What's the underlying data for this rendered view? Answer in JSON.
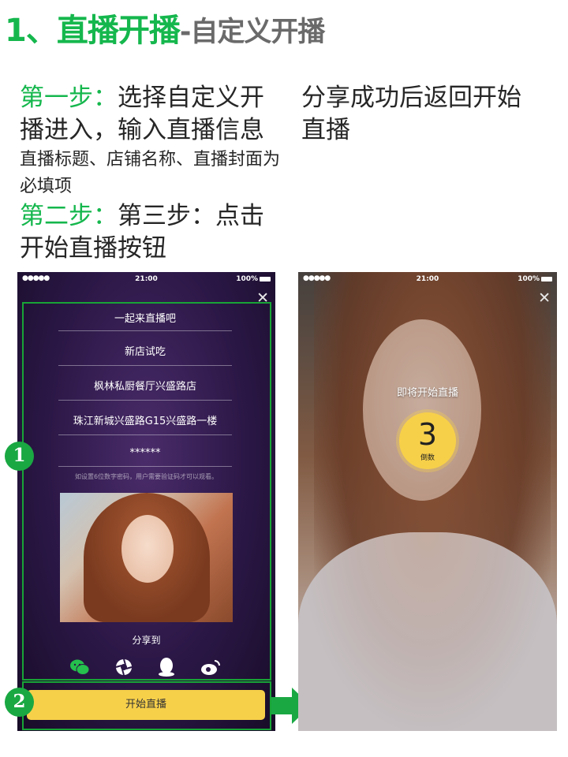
{
  "slide": {
    "title_num": "1、",
    "title_main": "直播开播",
    "title_sub": "-自定义开播"
  },
  "instructions": {
    "step1_label": "第一步：",
    "step1_text": "选择自定义开播进入，输入直播信息",
    "note": "直播标题、店铺名称、直播封面为必填项",
    "step2_label": "第二步：",
    "step2_text": "第三步：点击开始直播按钮"
  },
  "caption": "分享成功后返回开始直播",
  "status_bar": {
    "signal": "●●●●● ",
    "time": "21:00",
    "battery": "100%"
  },
  "setup_screen": {
    "close": "✕",
    "fields": [
      "一起来直播吧",
      "新店试吃",
      "枫林私厨餐厅兴盛路店",
      "珠江新城兴盛路G15兴盛路一楼",
      "******"
    ],
    "password_hint": "如设置6位数字密码，用户需要验证码才可以观看。",
    "share_to": "分享到",
    "share_icons": [
      "wechat-icon",
      "moments-icon",
      "qq-icon",
      "weibo-icon"
    ],
    "start_button": "开始直播"
  },
  "countdown_screen": {
    "close": "✕",
    "message": "即将开始直播",
    "count": "3",
    "count_label": "倒数"
  },
  "badges": {
    "one": "1",
    "two": "2"
  },
  "colors": {
    "accent_green": "#15b74d",
    "frame_green": "#18a436",
    "button_yellow": "#f7d04a"
  }
}
